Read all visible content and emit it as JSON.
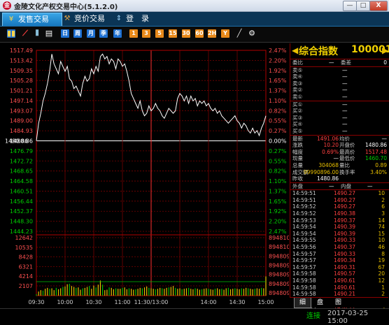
{
  "window": {
    "title": "金陵文化产权交易中心(5.1.2.0)",
    "logo_glyph": "金",
    "buttons": [
      "—",
      "□",
      "X"
    ]
  },
  "tabs": [
    {
      "label": "发售交易",
      "icon": "yen-icon",
      "active": true
    },
    {
      "label": "竞价交易",
      "icon": "hammer-icon",
      "active": false
    },
    {
      "label": "登　录",
      "icon": "updown-icon",
      "active": false
    }
  ],
  "toolbar": {
    "buttons": [
      {
        "name": "bar-chart-icon",
        "text": "▮▮",
        "style": "plain"
      },
      {
        "name": "line-chart-icon",
        "text": "⟋",
        "style": "plain"
      },
      {
        "name": "candle-icon",
        "text": "⫴",
        "style": "plain"
      },
      {
        "name": "table-icon",
        "text": "▤",
        "style": "plain"
      },
      {
        "name": "period-1",
        "text": "日",
        "style": "blue"
      },
      {
        "name": "period-2",
        "text": "周",
        "style": "blue"
      },
      {
        "name": "period-3",
        "text": "月",
        "style": "blue"
      },
      {
        "name": "period-4",
        "text": "季",
        "style": "blue"
      },
      {
        "name": "period-5",
        "text": "年",
        "style": "blue"
      },
      {
        "name": "min-1",
        "text": "1",
        "style": "orange"
      },
      {
        "name": "min-3",
        "text": "3",
        "style": "orange"
      },
      {
        "name": "min-5",
        "text": "5",
        "style": "orange"
      },
      {
        "name": "min-15",
        "text": "15",
        "style": "orange"
      },
      {
        "name": "min-30",
        "text": "30",
        "style": "orange"
      },
      {
        "name": "min-60",
        "text": "60",
        "style": "orange"
      },
      {
        "name": "min-120",
        "text": "2H",
        "style": "orange"
      },
      {
        "name": "min-y",
        "text": "Y",
        "style": "orange"
      },
      {
        "name": "draw-icon",
        "text": "╱",
        "style": "plain"
      },
      {
        "name": "gear-icon",
        "text": "⚙",
        "style": "plain"
      }
    ]
  },
  "chart_data": {
    "type": "line",
    "price_ticks": [
      "1517.49",
      "1513.42",
      "1509.35",
      "1505.28",
      "1501.21",
      "1497.14",
      "1493.07",
      "1489.00",
      "1484.93",
      "1480.86",
      "1476.79",
      "1472.72",
      "1468.65",
      "1464.58",
      "1460.51",
      "1456.44",
      "1452.37",
      "1448.30",
      "1444.23"
    ],
    "pct_ticks": [
      "2.47%",
      "2.20%",
      "1.92%",
      "1.65%",
      "1.37%",
      "1.10%",
      "0.82%",
      "0.55%",
      "0.27%",
      "0.00%",
      "0.27%",
      "0.55%",
      "0.82%",
      "1.10%",
      "1.37%",
      "1.65%",
      "1.92%",
      "2.20%",
      "2.47%"
    ],
    "volume_ticks_left": [
      "12642",
      "10535",
      "8428",
      "6321",
      "4214",
      "2107"
    ],
    "volume_ticks_right": [
      "8948101",
      "8948100",
      "8948099",
      "8948098",
      "8948097",
      "8948096",
      "8948095"
    ],
    "x_ticks": [
      "09:30",
      "10:00",
      "10:30",
      "11:00",
      "11:30/13:00",
      "14:00",
      "14:30",
      "15:00"
    ],
    "base_price": 1480.86,
    "price_range": [
      1444.23,
      1517.49
    ],
    "volume_max": 12642,
    "prices": [
      1480.9,
      1488,
      1492,
      1497,
      1500,
      1504,
      1509,
      1516,
      1512,
      1510,
      1508,
      1513,
      1511,
      1509,
      1511,
      1506,
      1505,
      1502,
      1503,
      1501,
      1499,
      1504,
      1507,
      1505,
      1506,
      1510,
      1508,
      1511,
      1509,
      1515,
      1516,
      1514,
      1515,
      1512,
      1514,
      1513,
      1510,
      1514,
      1513,
      1511,
      1512,
      1509,
      1505,
      1500,
      1498,
      1496,
      1494,
      1497,
      1493,
      1491,
      1492,
      1495,
      1493,
      1494,
      1496,
      1494,
      1493,
      1491,
      1490,
      1492,
      1494,
      1493,
      1492,
      1493,
      1498,
      1500,
      1499,
      1497,
      1499,
      1496,
      1499,
      1497,
      1498,
      1495,
      1497,
      1496,
      1497,
      1495,
      1496,
      1494,
      1493,
      1494,
      1492,
      1493,
      1491,
      1490,
      1489,
      1488,
      1489,
      1490,
      1491,
      1489,
      1488,
      1486,
      1488,
      1487,
      1485,
      1484,
      1486,
      1484,
      1485,
      1483,
      1486,
      1488,
      1491
    ],
    "volumes": [
      300,
      900,
      1200,
      1100,
      1500,
      1700,
      1500,
      1600,
      1200,
      1700,
      1400,
      1600,
      1900,
      2000,
      2500,
      2600,
      2100,
      1900,
      1700,
      1800,
      1300,
      1600,
      1700,
      1900,
      2100,
      1500,
      2200,
      1800,
      2400,
      3300,
      2400,
      1200,
      1300,
      1800,
      1700,
      1400,
      1600,
      1500,
      1500,
      1700,
      1800,
      1400,
      1600,
      1500,
      1300,
      1400,
      1500,
      1700,
      1600,
      1800,
      2000,
      1700,
      1600,
      1500,
      1400,
      1500,
      1700,
      1600,
      1500,
      1700,
      1800,
      1900,
      2100,
      1700,
      1500,
      1600,
      1400,
      1500,
      1600,
      1700,
      1500,
      1400,
      1600,
      1500,
      1300,
      1400,
      1500,
      1600,
      1500,
      1400,
      1300,
      1500,
      1600,
      1400,
      1500,
      1300,
      1600,
      1700,
      1400,
      1500,
      1600,
      1500,
      1400,
      1600,
      1500,
      1700,
      1600,
      1500,
      1400,
      1500,
      1600,
      1500,
      1700,
      1600,
      4200
    ]
  },
  "quote": {
    "name": "综合指数",
    "code": "100001",
    "wei_bi_label": "委比",
    "wei_bi": "—",
    "wei_cha_label": "委差",
    "wei_cha": "0",
    "asks": [
      {
        "label": "卖⑤",
        "price": "—",
        "vol": ""
      },
      {
        "label": "卖④",
        "price": "—",
        "vol": ""
      },
      {
        "label": "卖③",
        "price": "—",
        "vol": ""
      },
      {
        "label": "卖②",
        "price": "—",
        "vol": ""
      },
      {
        "label": "卖①",
        "price": "—",
        "vol": ""
      }
    ],
    "bids": [
      {
        "label": "买①",
        "price": "—",
        "vol": ""
      },
      {
        "label": "买②",
        "price": "—",
        "vol": ""
      },
      {
        "label": "买③",
        "price": "—",
        "vol": ""
      },
      {
        "label": "买④",
        "price": "—",
        "vol": ""
      },
      {
        "label": "买⑤",
        "price": "—",
        "vol": ""
      }
    ],
    "stats": [
      {
        "l1": "最新",
        "v1": "1491.06",
        "c1": "red",
        "l2": "均价",
        "v2": "—",
        "c2": "white"
      },
      {
        "l1": "涨跌",
        "v1": "10.20",
        "c1": "red",
        "l2": "开盘价",
        "v2": "1480.86",
        "c2": "white"
      },
      {
        "l1": "幅度",
        "v1": "0.69%",
        "c1": "red",
        "l2": "最高价",
        "v2": "1517.48",
        "c2": "red"
      },
      {
        "l1": "现量",
        "v1": "—",
        "c1": "white",
        "l2": "最低价",
        "v2": "1460.70",
        "c2": "green"
      },
      {
        "l1": "总量",
        "v1": "304068",
        "c1": "yellow",
        "l2": "量比",
        "v2": "0.89",
        "c2": "yellow"
      },
      {
        "l1": "成交额",
        "v1": "99990896.00",
        "c1": "yellow",
        "l2": "换手率",
        "v2": "3.40%",
        "c2": "yellow"
      },
      {
        "l1": "昨收",
        "v1": "1480.86",
        "c1": "white",
        "l2": "",
        "v2": "",
        "c2": "white"
      }
    ],
    "waipan_label": "外盘",
    "waipan": "—",
    "neipan_label": "内盘",
    "neipan": "—",
    "ticks": [
      {
        "time": "14:59:51",
        "price": "1490.27",
        "vol": "10"
      },
      {
        "time": "14:59:51",
        "price": "1490.27",
        "vol": "2"
      },
      {
        "time": "14:59:52",
        "price": "1490.27",
        "vol": "6"
      },
      {
        "time": "14:59:52",
        "price": "1490.38",
        "vol": "3"
      },
      {
        "time": "14:59:53",
        "price": "1490.37",
        "vol": "14"
      },
      {
        "time": "14:59:54",
        "price": "1490.39",
        "vol": "74"
      },
      {
        "time": "14:59:54",
        "price": "1490.39",
        "vol": "15"
      },
      {
        "time": "14:59:55",
        "price": "1490.33",
        "vol": "10"
      },
      {
        "time": "14:59:56",
        "price": "1490.37",
        "vol": "46"
      },
      {
        "time": "14:59:57",
        "price": "1490.33",
        "vol": "8"
      },
      {
        "time": "14:59:57",
        "price": "1490.34",
        "vol": "19"
      },
      {
        "time": "14:59:57",
        "price": "1490.31",
        "vol": "67"
      },
      {
        "time": "14:59:58",
        "price": "1490.57",
        "vol": "20"
      },
      {
        "time": "14:59:58",
        "price": "1490.61",
        "vol": "12"
      },
      {
        "time": "14:59:58",
        "price": "1490.61",
        "vol": "1"
      },
      {
        "time": "14:59:58",
        "price": "1490.21",
        "vol": "2"
      },
      {
        "time": "14:59:58",
        "price": "1490.11",
        "vol": "3"
      },
      {
        "time": "14:59:59",
        "price": "1490.11",
        "vol": "5"
      },
      {
        "time": "14:59:59",
        "price": "1492.24",
        "vol": "1"
      }
    ]
  },
  "bottom_tabs": [
    "细",
    "盘",
    "图"
  ],
  "status": {
    "connection": "连接",
    "datetime": "2017-03-25 15:00"
  }
}
